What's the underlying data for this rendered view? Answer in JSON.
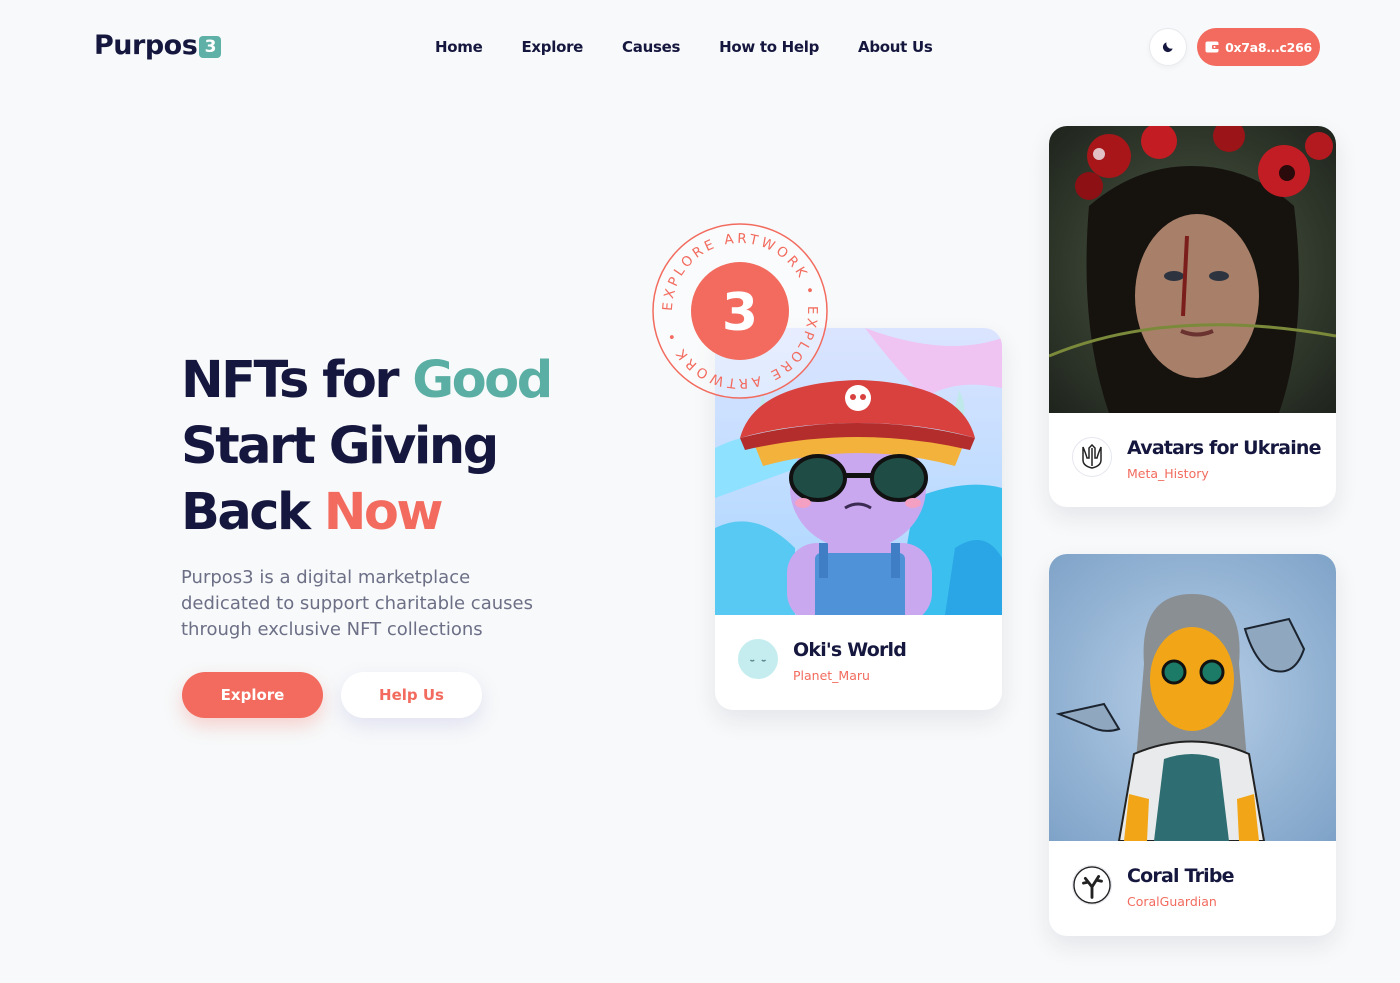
{
  "header": {
    "logo_text": "Purpos",
    "logo_badge": "3",
    "nav": [
      {
        "label": "Home"
      },
      {
        "label": "Explore"
      },
      {
        "label": "Causes"
      },
      {
        "label": "How to Help"
      },
      {
        "label": "About Us"
      }
    ],
    "theme_icon": "moon-icon",
    "wallet_icon": "wallet-icon",
    "wallet_address": "0x7a8...c266"
  },
  "hero": {
    "line1_plain": "NFTs for ",
    "line1_accent": "Good",
    "line2": "Start Giving",
    "line3_plain": "Back ",
    "line3_accent": "Now",
    "description": "Purpos3 is a digital marketplace dedicated to support charitable causes through exclusive NFT collections",
    "primary_button": "Explore",
    "secondary_button": "Help Us"
  },
  "stamp": {
    "ring_text": "EXPLORE ARTWORK • EXPLORE ARTWORK •",
    "center": "3"
  },
  "cards": [
    {
      "title": "Oki's World",
      "creator": "Planet_Maru",
      "avatar_icon": "cloud-face-icon"
    },
    {
      "title": "Avatars for Ukraine",
      "creator": "Meta_History",
      "avatar_icon": "trident-icon"
    },
    {
      "title": "Coral Tribe",
      "creator": "CoralGuardian",
      "avatar_icon": "coral-icon"
    }
  ],
  "colors": {
    "brand_dark": "#16173e",
    "accent_red": "#f26b5e",
    "accent_green": "#5aaea3",
    "background": "#f7f9fa"
  }
}
